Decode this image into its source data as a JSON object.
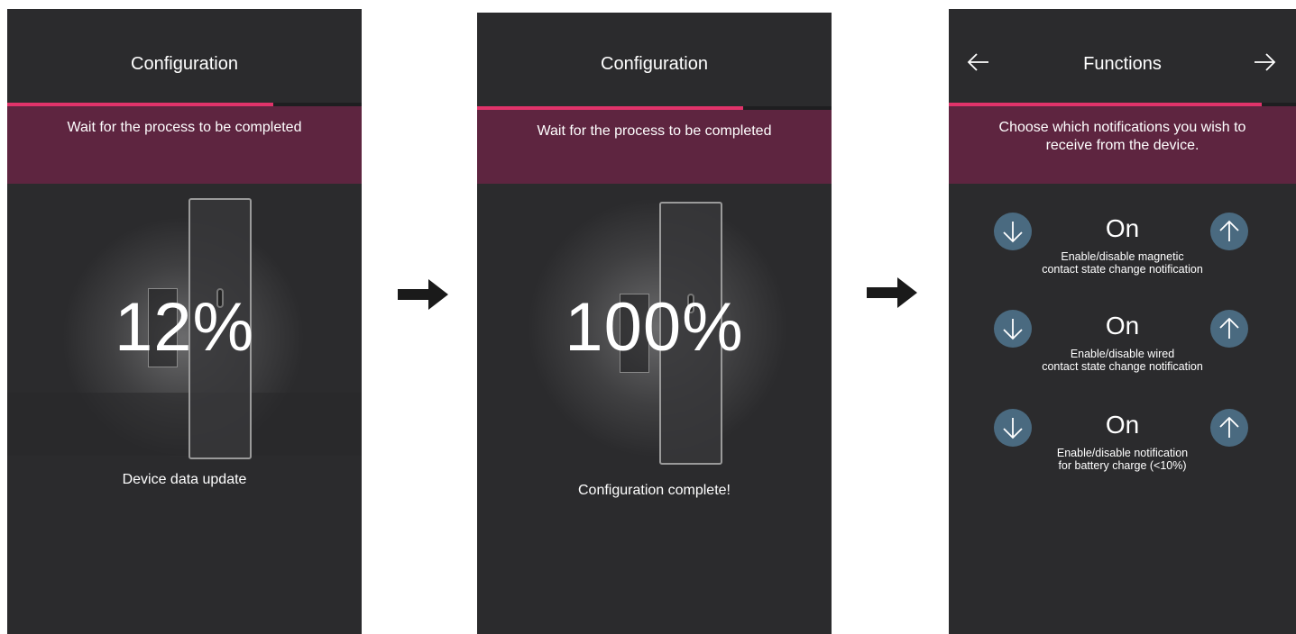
{
  "screens": [
    {
      "title": "Configuration",
      "banner": "Wait for the process to be completed",
      "progress_fraction": 0.75,
      "percent": "12%",
      "status": "Device data update"
    },
    {
      "title": "Configuration",
      "banner": "Wait for the process to be completed",
      "progress_fraction": 0.75,
      "percent": "100%",
      "status": "Configuration complete!"
    },
    {
      "title": "Functions",
      "banner_line1": "Choose which notifications you wish to",
      "banner_line2": "receive from the device.",
      "progress_fraction": 0.9,
      "rows": [
        {
          "value": "On",
          "label_line1": "Enable/disable magnetic",
          "label_line2": "contact state change notification"
        },
        {
          "value": "On",
          "label_line1": "Enable/disable wired",
          "label_line2": "contact state change notification"
        },
        {
          "value": "On",
          "label_line1": "Enable/disable notification",
          "label_line2": "for battery charge (<10%)"
        }
      ]
    }
  ],
  "icons": {
    "back": "arrow-left-icon",
    "next": "arrow-right-icon",
    "decrease": "arrow-down-icon",
    "increase": "arrow-up-icon",
    "flow": "flow-arrow-icon"
  },
  "colors": {
    "background": "#2b2b2d",
    "accent": "#e0336a",
    "banner": "#5e2540",
    "button": "#4a6a80"
  }
}
